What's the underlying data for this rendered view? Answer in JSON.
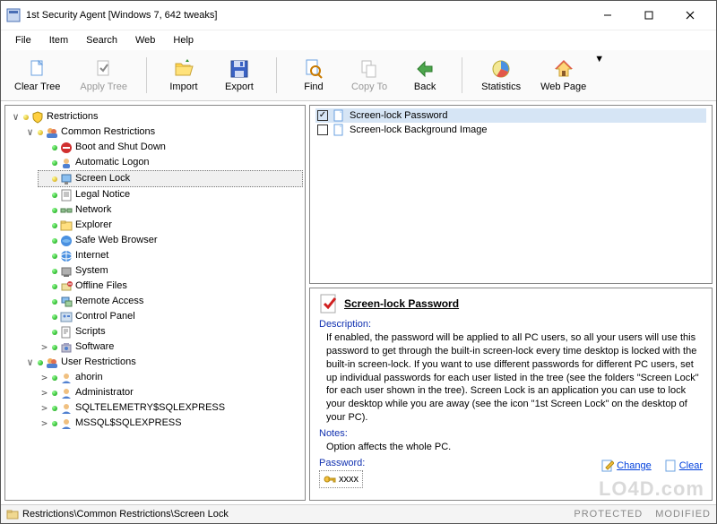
{
  "window": {
    "title": "1st Security Agent [Windows 7, 642 tweaks]"
  },
  "menu": {
    "file": "File",
    "item": "Item",
    "search": "Search",
    "web": "Web",
    "help": "Help"
  },
  "toolbar": {
    "clear_tree": "Clear Tree",
    "apply_tree": "Apply Tree",
    "import": "Import",
    "export": "Export",
    "find": "Find",
    "copy_to": "Copy To",
    "back": "Back",
    "statistics": "Statistics",
    "web_page": "Web Page"
  },
  "tree": {
    "root": {
      "label": "Restrictions",
      "children": {
        "common": {
          "label": "Common Restrictions",
          "items": [
            "Boot and Shut Down",
            "Automatic Logon",
            "Screen Lock",
            "Legal Notice",
            "Network",
            "Explorer",
            "Safe Web Browser",
            "Internet",
            "System",
            "Offline Files",
            "Remote Access",
            "Control Panel",
            "Scripts",
            "Software"
          ],
          "selected_index": 2
        },
        "user": {
          "label": "User Restrictions",
          "items": [
            "ahorin",
            "Administrator",
            "SQLTELEMETRY$SQLEXPRESS",
            "MSSQL$SQLEXPRESS"
          ]
        }
      }
    }
  },
  "list": {
    "items": [
      {
        "label": "Screen-lock Password",
        "checked": true,
        "selected": true
      },
      {
        "label": "Screen-lock Background Image",
        "checked": false,
        "selected": false
      }
    ]
  },
  "detail": {
    "title": "Screen-lock Password",
    "desc_label": "Description:",
    "desc_text": "If enabled, the password will be applied to all PC users, so all your users will use this password to get through the built-in screen-lock every time desktop is locked with the built-in screen-lock. If you want to use different passwords for different PC users, set up individual passwords for each user listed in the tree  (see the folders \"Screen Lock\" for each user shown in the tree). Screen Lock is an application you can use to lock your desktop while you are away (see the icon \"1st Screen Lock\" on the desktop of your PC).",
    "notes_label": "Notes:",
    "notes_text": "Option affects the whole PC.",
    "password_label": "Password:",
    "password_value": "xxxx",
    "change": "Change",
    "clear": "Clear"
  },
  "status": {
    "path": "Restrictions\\Common Restrictions\\Screen Lock",
    "protected": "PROTECTED",
    "modified": "MODIFIED"
  },
  "watermark": "LO4D.com"
}
